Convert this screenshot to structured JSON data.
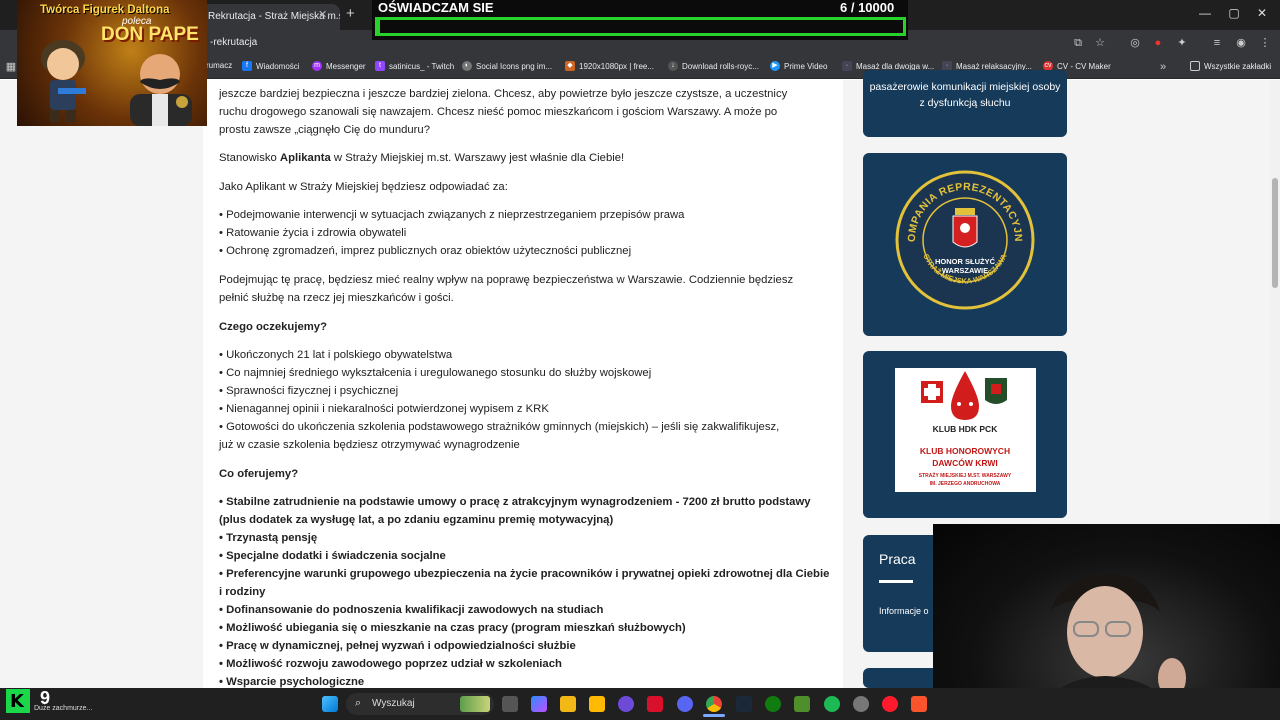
{
  "browser": {
    "tab_title": "Rekrutacja - Straż Miejska m.st.",
    "url": "-rekrutacja",
    "bookmarks": [
      {
        "label": "rumacz"
      },
      {
        "label": "Wiadomości"
      },
      {
        "label": "Messenger"
      },
      {
        "label": "satinicus_ - Twitch"
      },
      {
        "label": "Social Icons png im..."
      },
      {
        "label": "1920x1080px | free..."
      },
      {
        "label": "Download rolls-royc..."
      },
      {
        "label": "Prime Video"
      },
      {
        "label": "Masaż dla dwojga w..."
      },
      {
        "label": "Masaż relaksacyjny..."
      },
      {
        "label": "CV - CV Maker"
      }
    ],
    "all_bookmarks_label": "Wszystkie zakładki"
  },
  "counter": {
    "title": "OŚWIADCZAM SIE",
    "count_text": "6  / 10000",
    "progress": 0.0006
  },
  "overlay": {
    "line1": "Twórca Figurek Daltona",
    "line2": "poleca",
    "line3": "DON PAPE"
  },
  "article": {
    "intro": [
      "jeszcze bardziej bezpieczna i jeszcze bardziej zielona.  Chcesz, aby powietrze było jeszcze czystsze, a uczestnicy",
      "ruchu drogowego szanowali się nawzajem. Chcesz nieść pomoc mieszkańcom i gościom Warszawy. A może po",
      "prostu zawsze „ciągnęło Cię do munduru?"
    ],
    "position_pre": "Stanowisko ",
    "position_bold": "Aplikanta",
    "position_post": " w Straży Miejskiej m.st. Warszawy jest właśnie dla Ciebie!",
    "responsible_intro": "Jako Aplikant w Straży Miejskiej będziesz odpowiadać za:",
    "duties": [
      "• Podejmowanie interwencji w sytuacjach związanych z nieprzestrzeganiem przepisów prawa",
      "• Ratowanie życia i zdrowia obywateli",
      "• Ochronę zgromadzeń, imprez publicznych oraz obiektów użyteczności publicznej"
    ],
    "impact": [
      "Podejmując tę pracę, będziesz mieć realny wpływ na poprawę bezpieczeństwa w Warszawie. Codziennie będziesz",
      "pełnić służbę na rzecz jej mieszkańców i gości."
    ],
    "expect_heading": "Czego oczekujemy?",
    "expectations": [
      "• Ukończonych 21 lat i polskiego obywatelstwa",
      "• Co najmniej średniego wykształcenia i uregulowanego stosunku do służby wojskowej",
      "• Sprawności fizycznej i psychicznej",
      "• Nienagannej opinii i niekaralności potwierdzonej wypisem z KRK",
      "• Gotowości do ukończenia szkolenia podstawowego strażników gminnych (miejskich) – jeśli się zakwalifikujesz,",
      "już w czasie szkolenia będziesz otrzymywać wynagrodzenie"
    ],
    "offer_heading": "Co oferujemy?",
    "offers": [
      "• Stabilne zatrudnienie na podstawie umowy o pracę z atrakcyjnym wynagrodzeniem - 7200 zł brutto podstawy",
      "(plus dodatek za wysługę lat, a po zdaniu egzaminu premię motywacyjną)",
      "• Trzynastą pensję",
      "• Specjalne dodatki i świadczenia socjalne",
      "• Preferencyjne warunki grupowego ubezpieczenia na życie pracowników i prywatnej opieki zdrowotnej dla Ciebie",
      "i rodziny",
      "• Dofinansowanie do podnoszenia kwalifikacji zawodowych na studiach",
      "• Możliwość ubiegania się o mieszkanie na czas pracy (program mieszkań służbowych)",
      "• Pracę w dynamicznej, pełnej wyzwań i odpowiedzialności służbie",
      "• Możliwość rozwoju zawodowego poprzez udział w szkoleniach",
      "• Wsparcie psychologiczne"
    ]
  },
  "sidebar": {
    "card1_text": "pasażerowie komunikacji miejskiej osoby z dysfunkcją słuchu",
    "badge_top": "KOMPANIA REPREZENTACYJNA",
    "badge_bottom": "STRAŻ MIEJSKA WARSZAWA",
    "badge_motto_1": "HONOR SŁUŻYĆ",
    "badge_motto_2": "WARSZAWIE",
    "hdk_club": "KLUB HDK PCK",
    "hdk_line1": "KLUB HONOROWYCH",
    "hdk_line2": "DAWCÓW KRWI",
    "hdk_line3": "STRAŻY MIEJSKIEJ M.ST. WARSZAWY",
    "hdk_line4": "IM. JERZEGO ANDRUCHOWA",
    "praca_title": "Praca",
    "praca_info": "Informacje o"
  },
  "taskbar": {
    "search_label": "Wyszukaj",
    "weather_temp": "9",
    "weather_label": "Duże zachmurze..."
  },
  "colors": {
    "accent_green": "#27d32b",
    "navy": "#153a5a",
    "badge_gold": "#e3c23b"
  }
}
